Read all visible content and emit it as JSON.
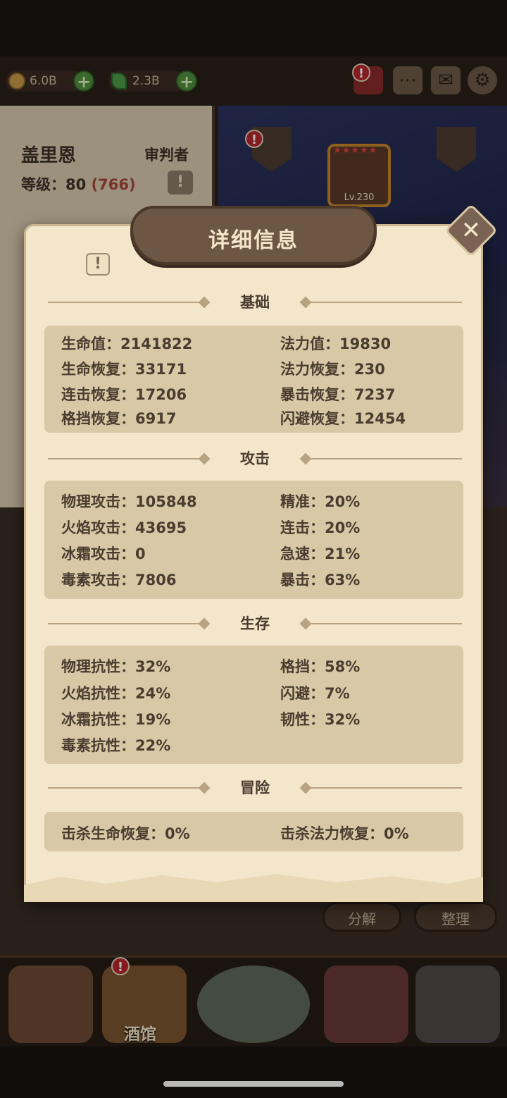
{
  "topbar": {
    "gold": "6.0B",
    "gems": "2.3B",
    "badge_mark": "!"
  },
  "hero": {
    "name": "盖里恩",
    "class": "审判者",
    "level_label": "等级：80",
    "level_extra": "(766)",
    "info_mark": "!"
  },
  "scene": {
    "slot_level": "Lv.230",
    "stars": "★★★★★"
  },
  "lower": {
    "decompose_label": "分解",
    "sort_label": "整理"
  },
  "bottom_nav": {
    "tavern_label": "酒馆"
  },
  "modal": {
    "title": "详细信息",
    "close_symbol": "✕",
    "info_mark": "!",
    "sections": [
      {
        "title": "基础",
        "stats": [
          "生命值：2141822",
          "法力值：19830",
          "生命恢复：33171",
          "法力恢复：230",
          "连击恢复：17206",
          "暴击恢复：7237",
          "格挡恢复：6917",
          "闪避恢复：12454"
        ]
      },
      {
        "title": "攻击",
        "stats": [
          "物理攻击：105848",
          "精准：20%",
          "火焰攻击：43695",
          "连击：20%",
          "冰霜攻击：0",
          "急速：21%",
          "毒素攻击：7806",
          "暴击：63%"
        ]
      },
      {
        "title": "生存",
        "stats": [
          "物理抗性：32%",
          "格挡：58%",
          "火焰抗性：24%",
          "闪避：7%",
          "冰霜抗性：19%",
          "韧性：32%",
          "毒素抗性：22%"
        ]
      },
      {
        "title": "冒险",
        "stats": [
          "击杀生命恢复：0%",
          "击杀法力恢复：0%"
        ]
      }
    ]
  }
}
